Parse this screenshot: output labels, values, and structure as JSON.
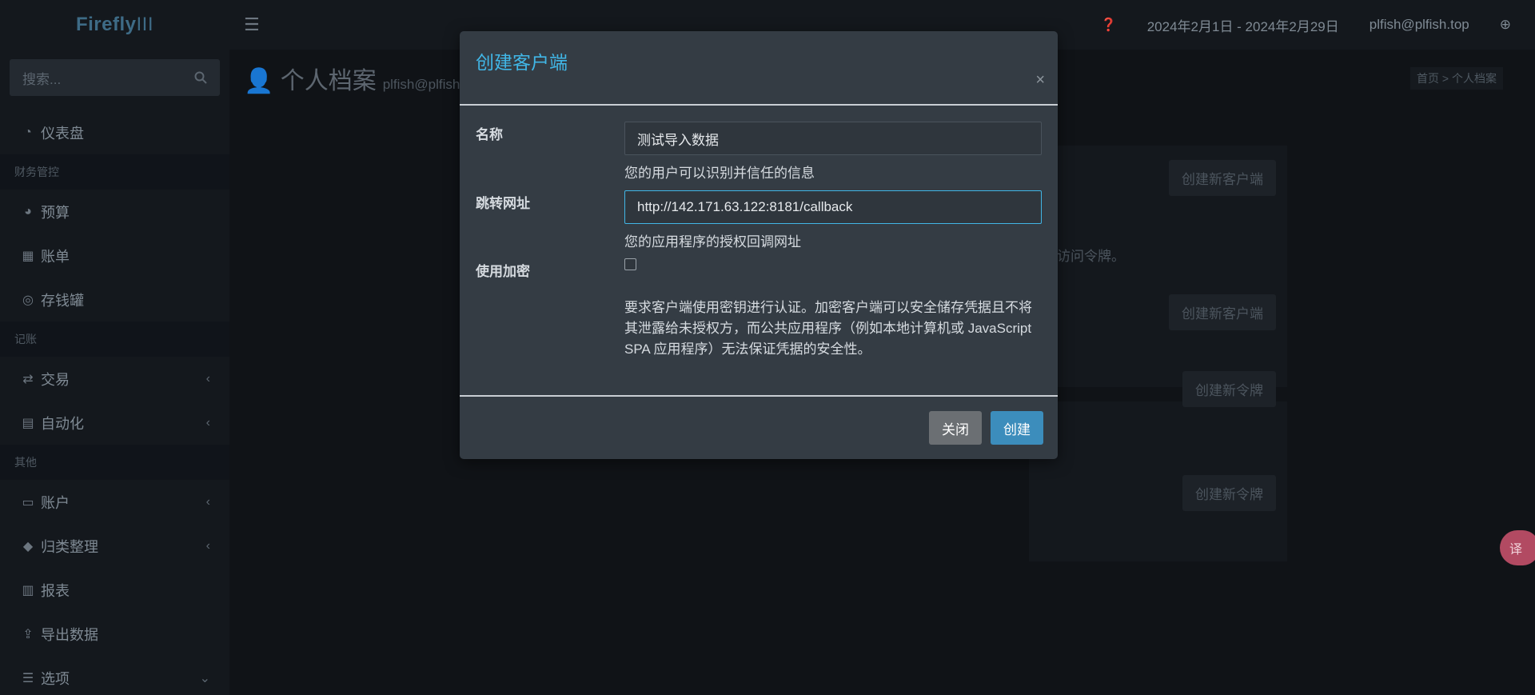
{
  "app": {
    "logo_bold": "Firefly",
    "logo_lite": "III"
  },
  "sidebar": {
    "search_placeholder": "搜索...",
    "items": [
      {
        "type": "item",
        "label": "仪表盘",
        "icon": "dashboard-icon"
      },
      {
        "type": "header",
        "label": "财务管控"
      },
      {
        "type": "item",
        "label": "预算",
        "icon": "pie-chart-icon"
      },
      {
        "type": "item",
        "label": "账单",
        "icon": "calendar-icon"
      },
      {
        "type": "item",
        "label": "存钱罐",
        "icon": "bullseye-icon"
      },
      {
        "type": "header",
        "label": "记账"
      },
      {
        "type": "item",
        "label": "交易",
        "icon": "exchange-icon",
        "chevron": "left"
      },
      {
        "type": "item",
        "label": "自动化",
        "icon": "database-icon",
        "chevron": "left"
      },
      {
        "type": "header",
        "label": "其他"
      },
      {
        "type": "item",
        "label": "账户",
        "icon": "credit-card-icon",
        "chevron": "left"
      },
      {
        "type": "item",
        "label": "归类整理",
        "icon": "tags-icon",
        "chevron": "left"
      },
      {
        "type": "item",
        "label": "报表",
        "icon": "bar-chart-icon"
      },
      {
        "type": "item",
        "label": "导出数据",
        "icon": "upload-icon"
      },
      {
        "type": "item",
        "label": "选项",
        "icon": "sliders-icon",
        "chevron": "down"
      }
    ]
  },
  "topbar": {
    "date_range": "2024年2月1日 - 2024年2月29日",
    "user_email": "plfish@plfish.top"
  },
  "page": {
    "title": "个人档案",
    "subtitle": "plfish@plfish.t",
    "breadcrumb": "首页  >  个人档案",
    "bg_buttons": [
      "创建新客户端",
      "创建新客户端",
      "创建新令牌",
      "创建新令牌"
    ],
    "bg_text": "访问令牌。"
  },
  "modal": {
    "title": "创建客户端",
    "close_symbol": "×",
    "name_label": "名称",
    "name_value": "测试导入数据",
    "name_help": "您的用户可以识别并信任的信息",
    "redirect_label": "跳转网址",
    "redirect_value": "http://142.171.63.122:8181/callback",
    "redirect_help": "您的应用程序的授权回调网址",
    "confidential_label": "使用加密",
    "confidential_checked": false,
    "confidential_help": "要求客户端使用密钥进行认证。加密客户端可以安全储存凭据且不将其泄露给未授权方，而公共应用程序（例如本地计算机或 JavaScript SPA 应用程序）无法保证凭据的安全性。",
    "close_button": "关闭",
    "create_button": "创建"
  },
  "colors": {
    "accent": "#41b6e6",
    "primary_button": "#3c8dbc",
    "modal_bg": "#343c44"
  }
}
